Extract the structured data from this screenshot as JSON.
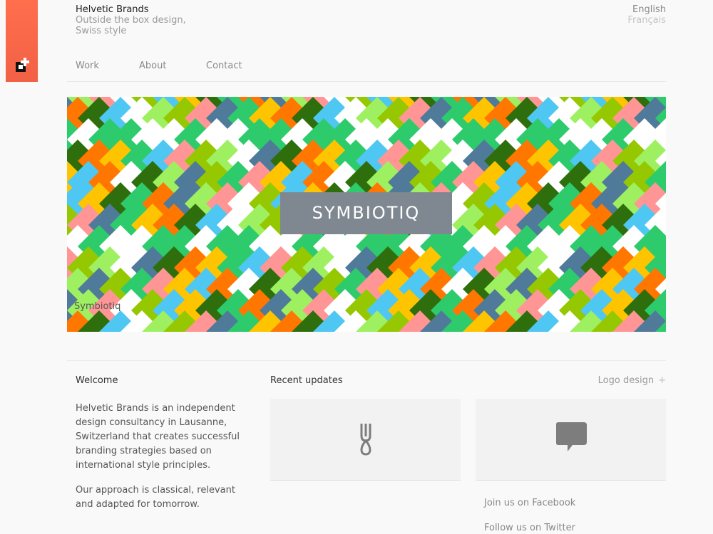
{
  "brand": {
    "name": "Helvetic Brands",
    "tagline_1": "Outside the box design,",
    "tagline_2": "Swiss style",
    "color": "#f26145"
  },
  "languages": [
    "English",
    "Français"
  ],
  "nav": [
    "Work",
    "About",
    "Contact"
  ],
  "hero": {
    "title": "SYMBIOTIQ",
    "caption": "Symbiotiq",
    "palette": [
      "#4f7a9a",
      "#2f6e0c",
      "#95c800",
      "#9ef060",
      "#2ecb6c",
      "#4fc7f3",
      "#ff9595",
      "#ff7700",
      "#ffc400",
      "#ffffff"
    ]
  },
  "welcome": {
    "title": "Welcome",
    "p1": "Helvetic Brands is an independent design consultancy in Lausanne, Switzerland that creates successful branding strategies based on international style principles.",
    "p2": "Our approach is classical, relevant and adapted for tomorrow."
  },
  "updates": {
    "title": "Recent updates",
    "filter": "Logo design",
    "filter_icon": "plus-icon",
    "cards": [
      {
        "icon": "fork-icon"
      },
      {
        "icon": "speech-bubble-icon"
      }
    ]
  },
  "social": {
    "facebook": "Join us on Facebook",
    "twitter": "Follow us on Twitter"
  }
}
